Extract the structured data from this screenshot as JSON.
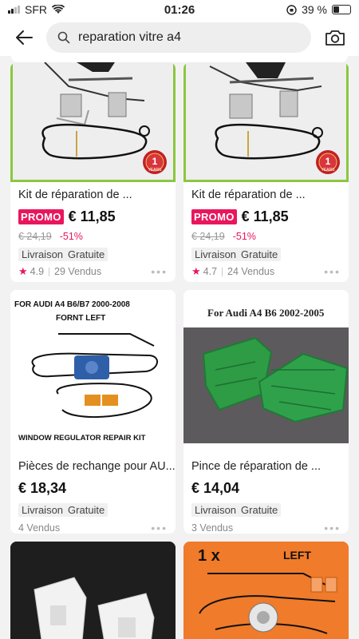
{
  "status_bar": {
    "carrier": "SFR",
    "time": "01:26",
    "battery": "39 %",
    "battery_level": 0.39
  },
  "search": {
    "query": "reparation vitre a4"
  },
  "products": [
    {
      "title": "Kit de réparation de ...",
      "promo": "PROMO",
      "price": "€ 11,85",
      "old_price": "€ 24,19",
      "discount": "-51%",
      "shipping_1": "Livraison",
      "shipping_2": "Gratuite",
      "rating": "4.9",
      "sold": "29 Vendus",
      "badge_num": "1",
      "badge_text": "YEARS"
    },
    {
      "title": "Kit de réparation de ...",
      "promo": "PROMO",
      "price": "€ 11,85",
      "old_price": "€ 24,19",
      "discount": "-51%",
      "shipping_1": "Livraison",
      "shipping_2": "Gratuite",
      "rating": "4.7",
      "sold": "24 Vendus",
      "badge_num": "1",
      "badge_text": "YEARS"
    },
    {
      "title": "Pièces de rechange pour AU...",
      "price": "€ 18,34",
      "shipping_1": "Livraison",
      "shipping_2": "Gratuite",
      "sold": "4 Vendus",
      "img_top_text_1": "FOR AUDI A4 B6/B7 2000-2008",
      "img_top_text_2": "FORNT LEFT",
      "img_bottom_text": "WINDOW REGULATOR REPAIR KIT"
    },
    {
      "title": "Pince de réparation de ...",
      "price": "€ 14,04",
      "shipping_1": "Livraison",
      "shipping_2": "Gratuite",
      "sold": "3 Vendus",
      "img_top_text": "For Audi A4 B6 2002-2005"
    },
    {
      "title": "",
      "price": ""
    },
    {
      "title": "",
      "img_text_1": "1 x",
      "img_text_2": "LEFT"
    }
  ],
  "more_label": "•••"
}
